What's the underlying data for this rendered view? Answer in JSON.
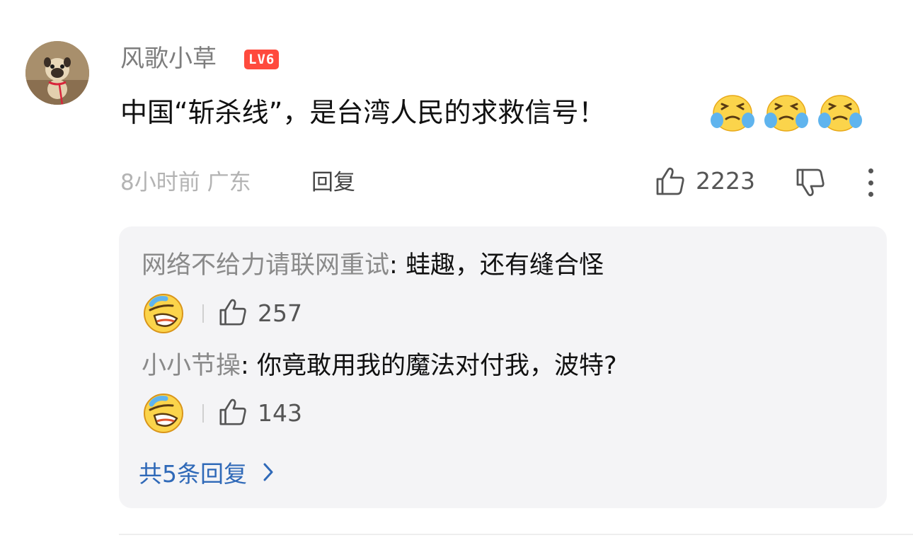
{
  "comment": {
    "username": "风歌小草",
    "level_badge": "LV6",
    "text": "中国“斩杀线”，是台湾人民的求救信号！",
    "emoji_icons": [
      "crying-laughing-emoji",
      "crying-laughing-emoji",
      "crying-laughing-emoji"
    ],
    "time_location": "8小时前 广东",
    "reply_label": "回复",
    "like_count": "2223"
  },
  "replies": [
    {
      "author": "网络不给力请联网重试",
      "separator": ": ",
      "text": "蛙趣，还有缝合怪",
      "emoji_icon": "rolling-laughing-emoji",
      "like_count": "257"
    },
    {
      "author": "小小节操",
      "separator": ": ",
      "text": "你竟敢用我的魔法对付我，波特?",
      "emoji_icon": "rolling-laughing-emoji",
      "like_count": "143"
    }
  ],
  "total_replies_label": "共5条回复",
  "colors": {
    "badge": "#ff4a3d",
    "link": "#2f69b8",
    "reply_box_bg": "#f4f4f6",
    "muted": "#8a8a8a"
  }
}
